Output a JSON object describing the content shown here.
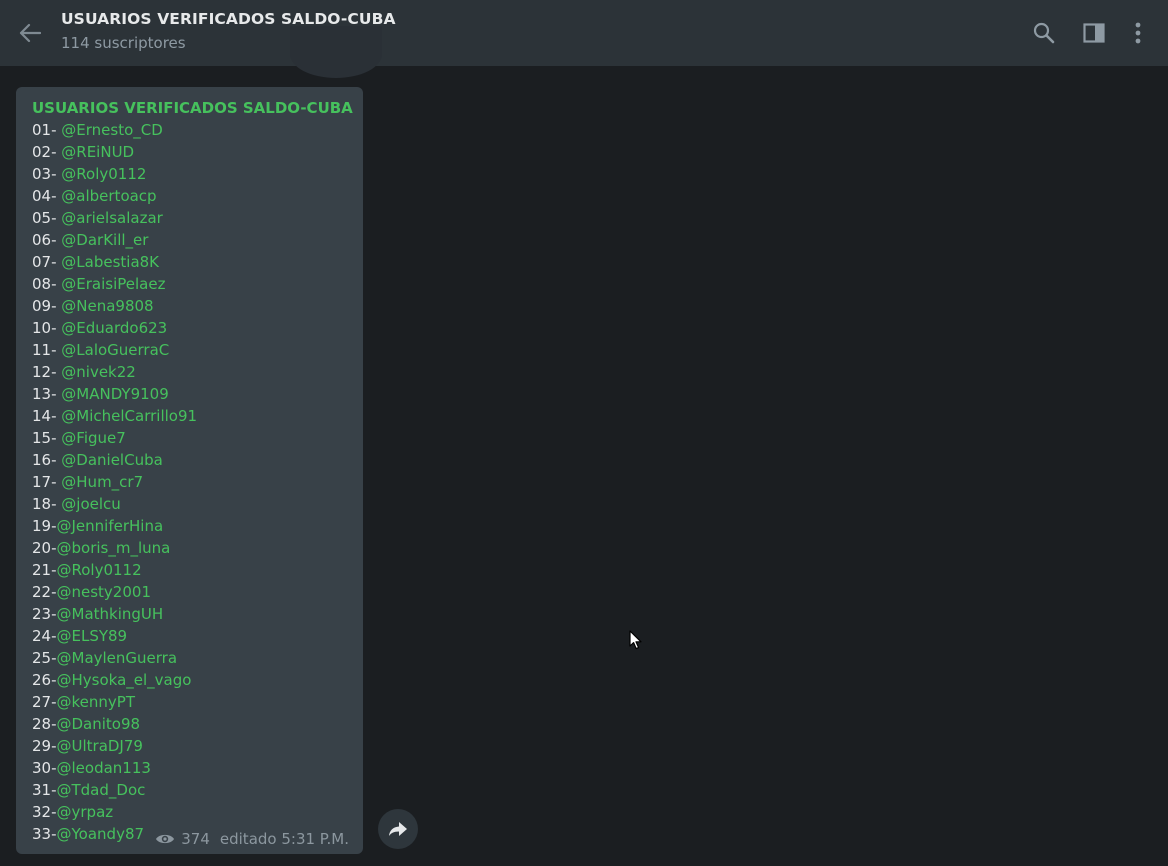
{
  "header": {
    "title": "USUARIOS VERIFICADOS SALDO-CUBA",
    "subtitle": "114 suscriptores",
    "icons": {
      "back": "arrow-left-icon",
      "search": "search-icon",
      "sidebar": "sidebar-toggle-icon",
      "more": "more-vertical-icon"
    }
  },
  "message": {
    "title": "USUARIOS VERIFICADOS SALDO-CUBA",
    "entries": [
      {
        "num": "01- ",
        "user": "@Ernesto_CD"
      },
      {
        "num": "02- ",
        "user": "@REiNUD"
      },
      {
        "num": "03- ",
        "user": "@Roly0112"
      },
      {
        "num": "04- ",
        "user": "@albertoacp"
      },
      {
        "num": "05- ",
        "user": "@arielsalazar"
      },
      {
        "num": "06- ",
        "user": "@DarKill_er"
      },
      {
        "num": "07- ",
        "user": "@Labestia8K"
      },
      {
        "num": "08- ",
        "user": "@EraisiPelaez"
      },
      {
        "num": "09- ",
        "user": "@Nena9808"
      },
      {
        "num": "10- ",
        "user": "@Eduardo623"
      },
      {
        "num": "11- ",
        "user": "@LaloGuerraC"
      },
      {
        "num": "12- ",
        "user": "@nivek22"
      },
      {
        "num": "13- ",
        "user": "@MANDY9109"
      },
      {
        "num": "14- ",
        "user": "@MichelCarrillo91"
      },
      {
        "num": "15- ",
        "user": "@Figue7"
      },
      {
        "num": "16- ",
        "user": "@DanielCuba"
      },
      {
        "num": "17- ",
        "user": "@Hum_cr7"
      },
      {
        "num": "18- ",
        "user": "@joelcu"
      },
      {
        "num": "19-",
        "user": "@JenniferHina"
      },
      {
        "num": "20-",
        "user": "@boris_m_luna"
      },
      {
        "num": "21-",
        "user": "@Roly0112"
      },
      {
        "num": "22-",
        "user": "@nesty2001"
      },
      {
        "num": "23-",
        "user": "@MathkingUH"
      },
      {
        "num": "24-",
        "user": "@ELSY89"
      },
      {
        "num": "25-",
        "user": "@MaylenGuerra"
      },
      {
        "num": "26-",
        "user": "@Hysoka_el_vago"
      },
      {
        "num": "27-",
        "user": "@kennyPT"
      },
      {
        "num": "28-",
        "user": "@Danito98"
      },
      {
        "num": "29-",
        "user": "@UltraDJ79"
      },
      {
        "num": "30-",
        "user": "@leodan113"
      },
      {
        "num": "31-",
        "user": "@Tdad_Doc"
      },
      {
        "num": "32-",
        "user": "@yrpaz"
      },
      {
        "num": "33-",
        "user": "@Yoandy87"
      }
    ],
    "views": "374",
    "edited": "editado 5:31 P.M."
  },
  "colors": {
    "header_bg": "#2c3338",
    "chat_bg": "#1b1e21",
    "bubble_bg": "#384148",
    "accent_green": "#46c15d",
    "muted_text": "#8c979f"
  },
  "actions": {
    "forward_icon": "share-arrow-icon"
  }
}
